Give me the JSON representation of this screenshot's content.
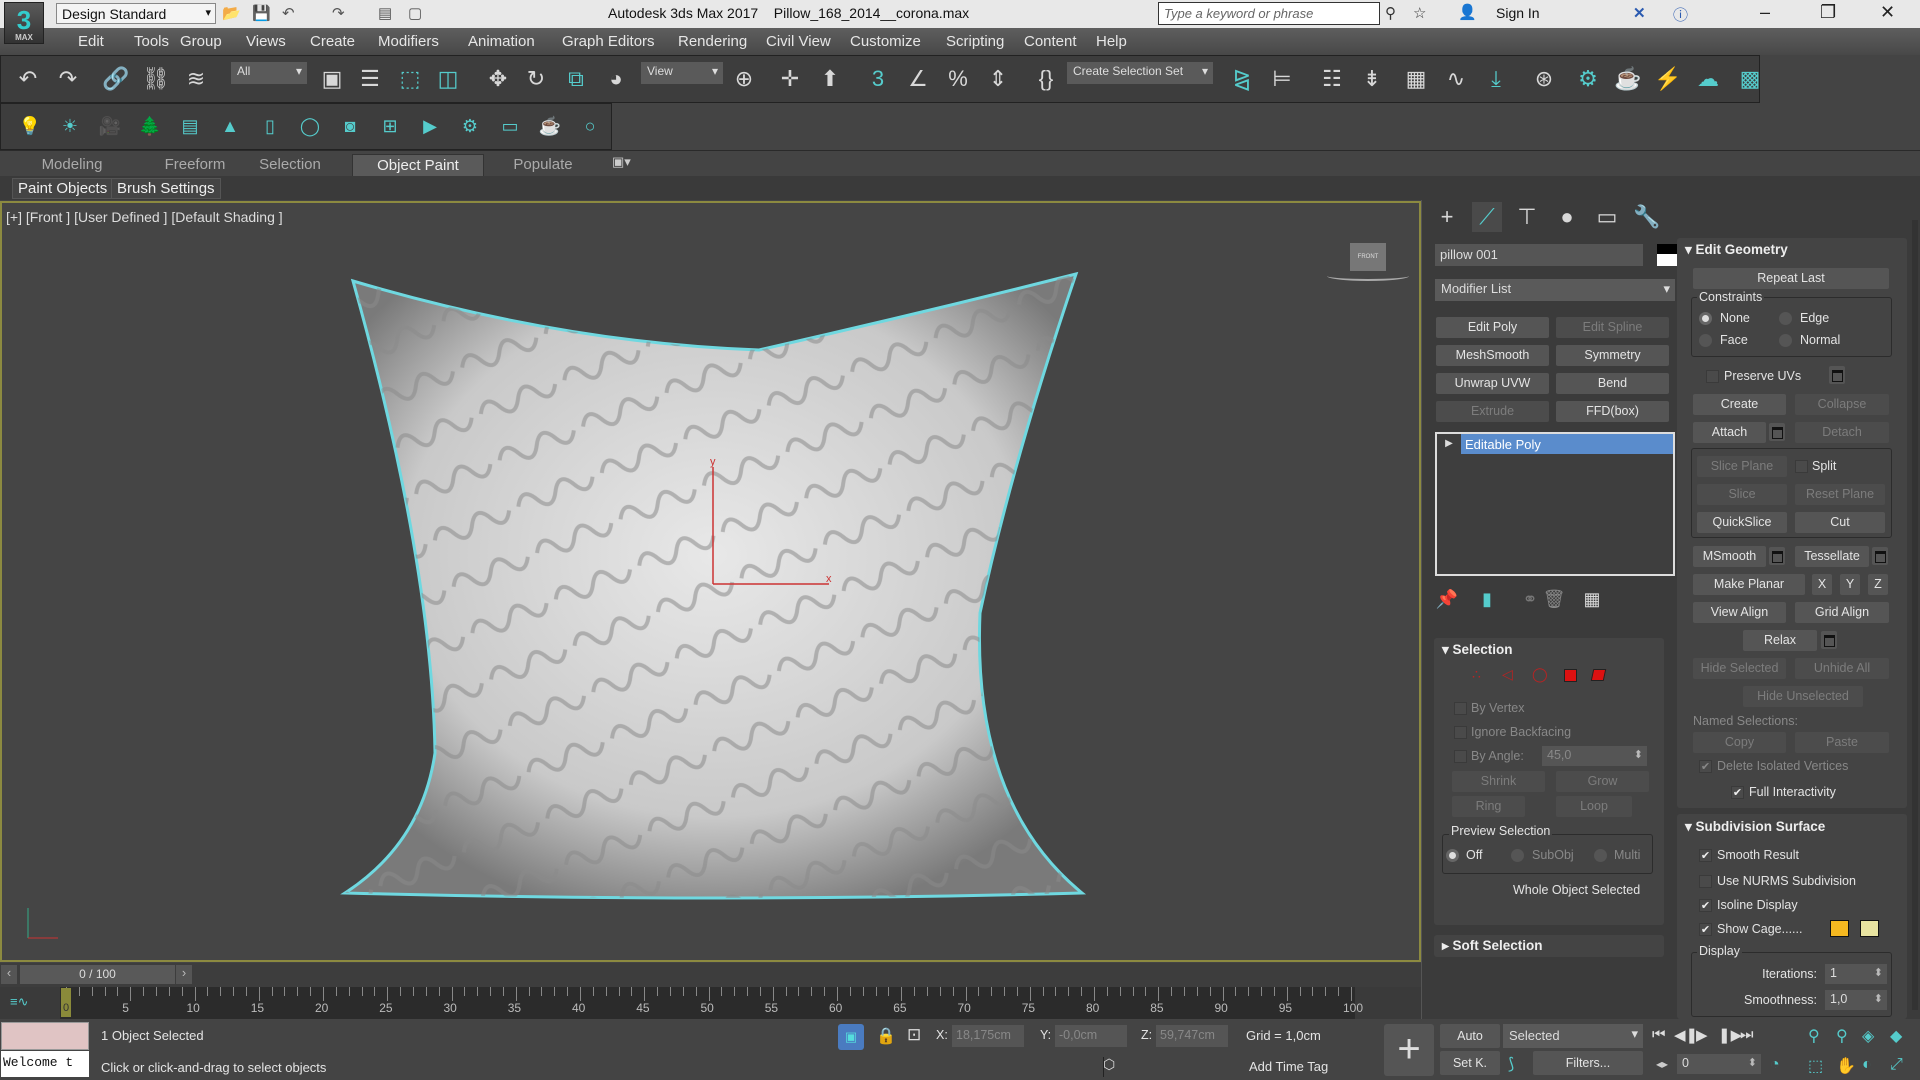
{
  "title": {
    "app": "Autodesk 3ds Max 2017",
    "file": "Pillow_168_2014__corona.max",
    "logo": "3",
    "logo_sub": "MAX",
    "workspace": "Design Standard",
    "search_placeholder": "Type a keyword or phrase",
    "sign_in": "Sign In"
  },
  "menu": [
    "Edit",
    "Tools",
    "Group",
    "Views",
    "Create",
    "Modifiers",
    "Animation",
    "Graph Editors",
    "Rendering",
    "Civil View",
    "Customize",
    "Scripting",
    "Content",
    "Help"
  ],
  "toolbar": {
    "filter": "All",
    "ref_coord": "View",
    "selection_set": "Create Selection Set"
  },
  "ribbon": {
    "tabs": [
      "Modeling",
      "Freeform",
      "Selection",
      "Object Paint",
      "Populate"
    ],
    "active_tab": "Object Paint",
    "sub": [
      "Paint Objects",
      "Brush Settings"
    ]
  },
  "viewport": {
    "label": "[+] [Front ] [User Defined ] [Default Shading ]",
    "viewcube": "FRONT",
    "axis_x": "x",
    "axis_y": "y",
    "selection_color": "#6fd8e0"
  },
  "command_panel": {
    "object_name": "pillow 001",
    "modifier_list": "Modifier List",
    "modifier_buttons": [
      {
        "label": "Edit Poly",
        "enabled": true
      },
      {
        "label": "Edit Spline",
        "enabled": false
      },
      {
        "label": "MeshSmooth",
        "enabled": true
      },
      {
        "label": "Symmetry",
        "enabled": true
      },
      {
        "label": "Unwrap UVW",
        "enabled": true
      },
      {
        "label": "Bend",
        "enabled": true
      },
      {
        "label": "Extrude",
        "enabled": false
      },
      {
        "label": "FFD(box)",
        "enabled": true
      }
    ],
    "stack": [
      "Editable Poly"
    ],
    "selection": {
      "title": "Selection",
      "by_vertex": "By Vertex",
      "ignore_backfacing": "Ignore Backfacing",
      "by_angle": "By Angle:",
      "angle_value": "45,0",
      "shrink": "Shrink",
      "grow": "Grow",
      "ring": "Ring",
      "loop": "Loop",
      "preview_title": "Preview Selection",
      "preview_off": "Off",
      "preview_subobj": "SubObj",
      "preview_multi": "Multi",
      "status": "Whole Object Selected"
    },
    "soft_selection": "Soft Selection",
    "edit_geometry": {
      "title": "Edit Geometry",
      "repeat_last": "Repeat Last",
      "constraints": "Constraints",
      "none": "None",
      "edge": "Edge",
      "face": "Face",
      "normal": "Normal",
      "preserve_uvs": "Preserve UVs",
      "create": "Create",
      "collapse": "Collapse",
      "attach": "Attach",
      "detach": "Detach",
      "slice_plane": "Slice Plane",
      "split": "Split",
      "slice": "Slice",
      "reset_plane": "Reset Plane",
      "quickslice": "QuickSlice",
      "cut": "Cut",
      "msmooth": "MSmooth",
      "tessellate": "Tessellate",
      "make_planar": "Make Planar",
      "x": "X",
      "y": "Y",
      "z": "Z",
      "view_align": "View Align",
      "grid_align": "Grid Align",
      "relax": "Relax",
      "hide_selected": "Hide Selected",
      "unhide_all": "Unhide All",
      "hide_unselected": "Hide Unselected",
      "named_selections": "Named Selections:",
      "copy": "Copy",
      "paste": "Paste",
      "delete_isolated": "Delete Isolated Vertices",
      "full_interactivity": "Full Interactivity"
    },
    "subdivision": {
      "title": "Subdivision Surface",
      "smooth_result": "Smooth Result",
      "use_nurms": "Use NURMS Subdivision",
      "isoline": "Isoline Display",
      "show_cage": "Show Cage......",
      "cage_color_1": "#f5b820",
      "cage_color_2": "#e8e3a0",
      "display": "Display",
      "iterations_label": "Iterations:",
      "iterations": "1",
      "smoothness_label": "Smoothness:",
      "smoothness": "1,0"
    }
  },
  "timeline": {
    "counter": "0 / 100",
    "start": 0,
    "end": 100,
    "current": 0,
    "label_step": 5
  },
  "status": {
    "selected": "1 Object Selected",
    "prompt": "Click or click-and-drag to select objects",
    "maxscript": "Welcome t",
    "x_label": "X:",
    "x": "18,175cm",
    "y_label": "Y:",
    "y": "-0,0cm",
    "z_label": "Z:",
    "z": "59,747cm",
    "grid": "Grid = 1,0cm",
    "add_time_tag": "Add Time Tag",
    "auto": "Auto",
    "set_key": "Set K.",
    "key_mode": "Selected",
    "filters": "Filters...",
    "frame": "0"
  }
}
